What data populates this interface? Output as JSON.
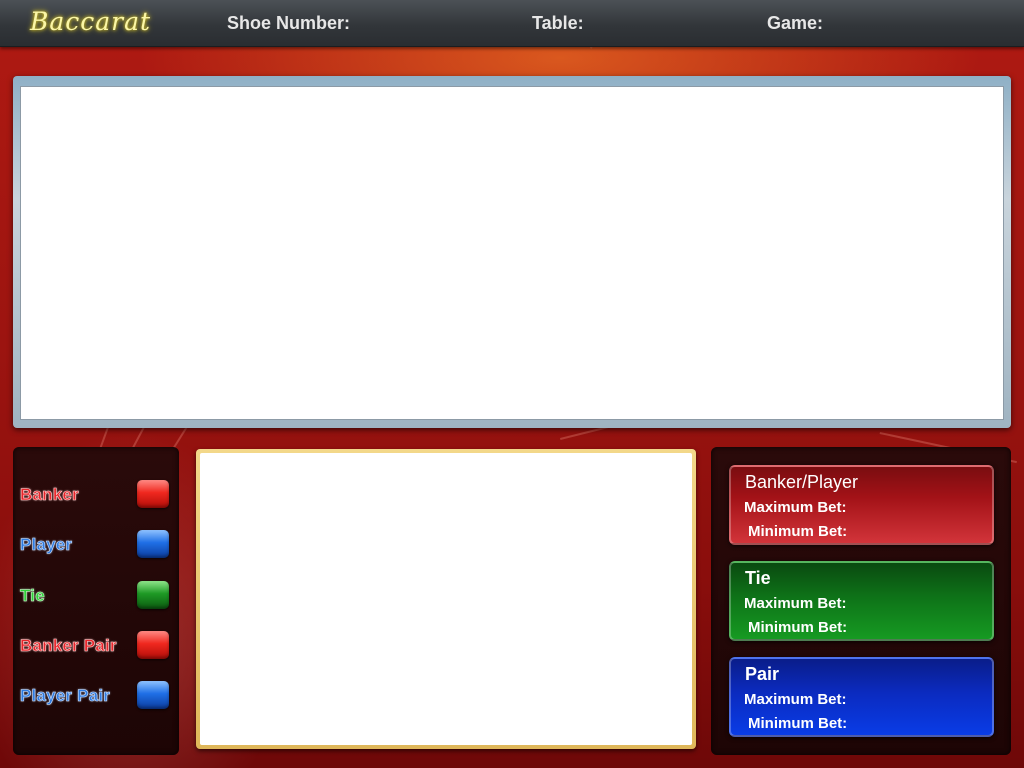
{
  "header": {
    "logo": "Baccarat",
    "shoe_number_label": "Shoe Number:",
    "table_label": "Table:",
    "game_label": "Game:"
  },
  "legend": {
    "items": [
      {
        "label": "Banker",
        "color": "#e8252a"
      },
      {
        "label": "Player",
        "color": "#2f7be0"
      },
      {
        "label": "Tie",
        "color": "#2fcf3a"
      },
      {
        "label": "Banker Pair",
        "color": "#e8252a"
      },
      {
        "label": "Player Pair",
        "color": "#2f7be0"
      }
    ]
  },
  "bets": {
    "banker_player": {
      "title": "Banker/Player",
      "max_label": "Maximum Bet:",
      "min_label": "Minimum Bet:",
      "color": "#a31217"
    },
    "tie": {
      "title": "Tie",
      "max_label": "Maximum Bet:",
      "min_label": "Minimum Bet:",
      "color": "#0e7318"
    },
    "pair": {
      "title": "Pair",
      "max_label": "Maximum Bet:",
      "min_label": "Minimum Bet:",
      "color": "#0b2bc0"
    }
  }
}
